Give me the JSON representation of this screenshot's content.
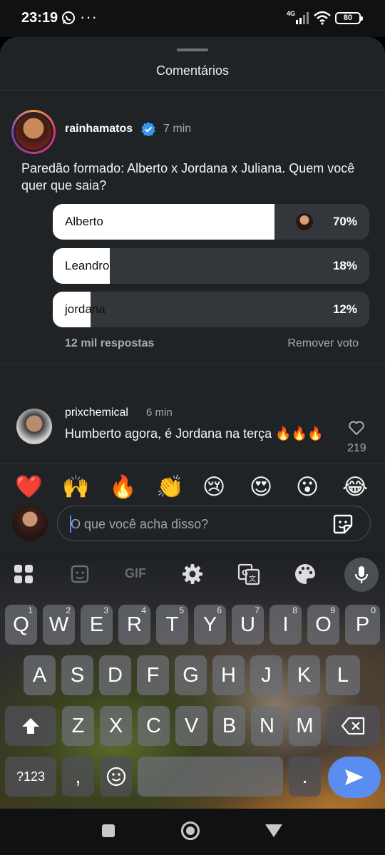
{
  "status_bar": {
    "time": "23:19",
    "more": "···",
    "network": "4G",
    "battery": "80"
  },
  "sheet": {
    "title": "Comentários"
  },
  "post": {
    "username": "rainhamatos",
    "verified": true,
    "time": "7 min",
    "text": "Paredão formado: Alberto x Jordana x Juliana. Quem você quer que saia?"
  },
  "poll": {
    "options": [
      {
        "label": "Alberto",
        "percent_text": "70%",
        "fraction": 0.7,
        "has_voter_avatar": true
      },
      {
        "label": "Leandro",
        "percent_text": "18%",
        "fraction": 0.18
      },
      {
        "label": "jordana",
        "percent_text": "12%",
        "fraction": 0.12
      }
    ],
    "responses": "12 mil respostas",
    "remove_vote": "Remover voto"
  },
  "comment": {
    "username": "prixchemical",
    "time": "6 min",
    "text": "Humberto agora, é Jordana na terça 🔥🔥🔥",
    "likes": "219"
  },
  "reactions": [
    "❤️",
    "🙌",
    "🔥",
    "👏",
    "😢",
    "😍",
    "😮",
    "😂"
  ],
  "composer": {
    "placeholder": "O que você acha disso?"
  },
  "keyboard": {
    "toolbar": [
      "apps-grid-icon",
      "sticker-icon",
      "GIF",
      "settings-gear-icon",
      "translate-icon",
      "palette-icon",
      "mic-icon"
    ],
    "gif_label": "GIF",
    "row1": [
      {
        "k": "Q",
        "s": "1"
      },
      {
        "k": "W",
        "s": "2"
      },
      {
        "k": "E",
        "s": "3"
      },
      {
        "k": "R",
        "s": "4"
      },
      {
        "k": "T",
        "s": "5"
      },
      {
        "k": "Y",
        "s": "6"
      },
      {
        "k": "U",
        "s": "7"
      },
      {
        "k": "I",
        "s": "8"
      },
      {
        "k": "O",
        "s": "9"
      },
      {
        "k": "P",
        "s": "0"
      }
    ],
    "row2": [
      "A",
      "S",
      "D",
      "F",
      "G",
      "H",
      "J",
      "K",
      "L"
    ],
    "row3": [
      "Z",
      "X",
      "C",
      "V",
      "B",
      "N",
      "M"
    ],
    "symbols": "?123",
    "comma": ",",
    "period": "."
  },
  "colors": {
    "accent": "#5a8df0",
    "sheet_bg": "#202326",
    "verified": "#3897f0"
  }
}
